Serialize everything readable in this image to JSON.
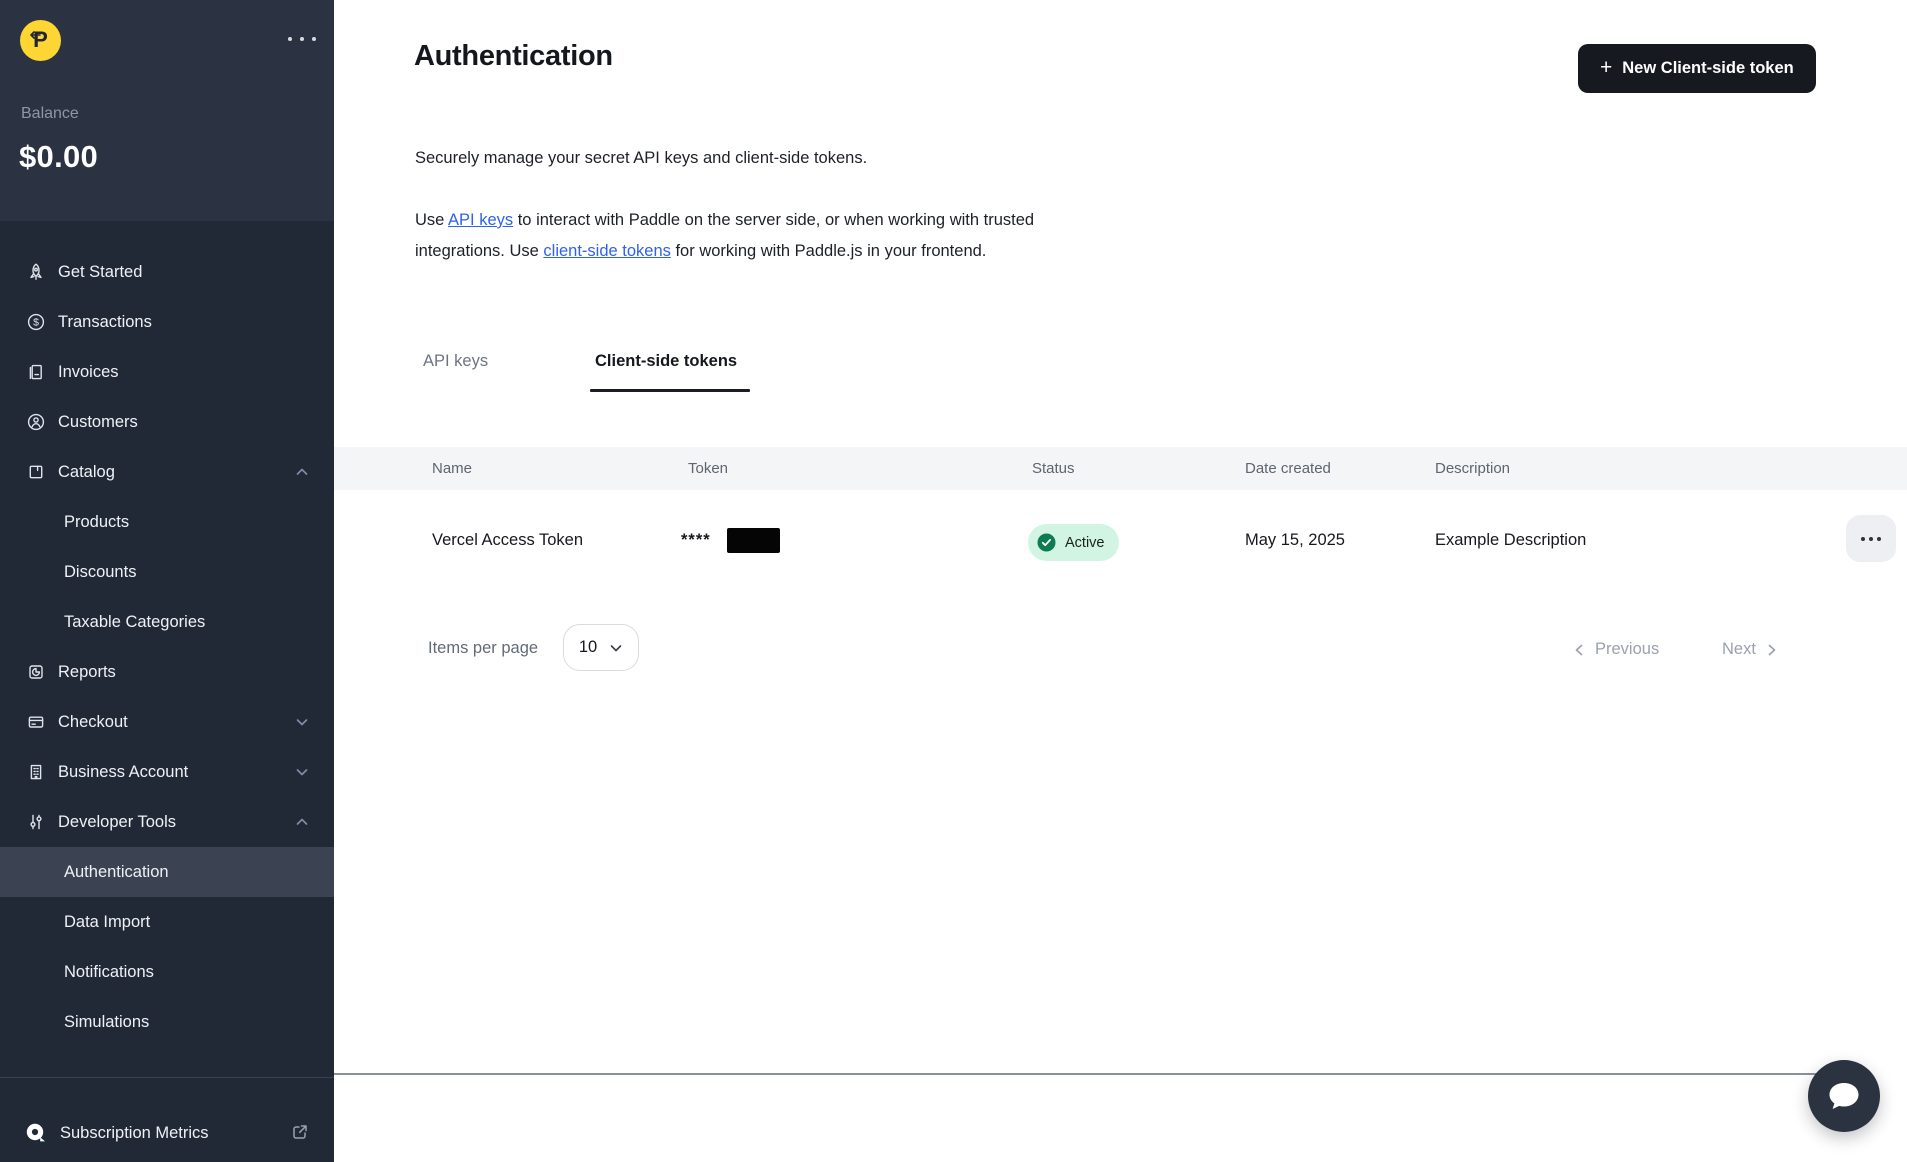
{
  "sidebar": {
    "balance_label": "Balance",
    "balance_value": "$0.00",
    "logo_letter": "P",
    "items": [
      {
        "label": "Get Started"
      },
      {
        "label": "Transactions"
      },
      {
        "label": "Invoices"
      },
      {
        "label": "Customers"
      },
      {
        "label": "Catalog"
      },
      {
        "label": "Products"
      },
      {
        "label": "Discounts"
      },
      {
        "label": "Taxable Categories"
      },
      {
        "label": "Reports"
      },
      {
        "label": "Checkout"
      },
      {
        "label": "Business Account"
      },
      {
        "label": "Developer Tools"
      },
      {
        "label": "Authentication"
      },
      {
        "label": "Data Import"
      },
      {
        "label": "Notifications"
      },
      {
        "label": "Simulations"
      }
    ],
    "footer_label": "Subscription Metrics"
  },
  "header": {
    "title": "Authentication",
    "new_token_button": "New Client-side token",
    "plus": "+"
  },
  "intro": {
    "line1": "Securely manage your secret API keys and client-side tokens.",
    "p2_part1": "Use ",
    "link1": "API keys",
    "p2_part2": " to interact with Paddle on the server side, or when working with trusted integrations. Use ",
    "link2": "client-side tokens",
    "p2_part3": " for working with Paddle.js in your frontend."
  },
  "tabs": [
    {
      "label": "API keys"
    },
    {
      "label": "Client-side tokens"
    }
  ],
  "table": {
    "columns": [
      "Name",
      "Token",
      "Status",
      "Date created",
      "Description"
    ],
    "rows": [
      {
        "name": "Vercel Access Token",
        "token_masked": "****",
        "status": "Active",
        "date_created": "May 15, 2025",
        "description": "Example Description"
      }
    ]
  },
  "pagination": {
    "items_per_page_label": "Items per page",
    "items_per_page_value": "10",
    "previous": "Previous",
    "next": "Next"
  },
  "colors": {
    "accent_yellow": "#fdd633",
    "sidebar_bg": "#222936",
    "sidebar_header_bg": "#2b3242",
    "active_item_bg": "#3b4251",
    "button_dark": "#16191f",
    "link_blue": "#2e62e9",
    "badge_bg": "#d2f5e3",
    "badge_green": "#0e7c52",
    "table_header_bg": "#f4f5f7"
  }
}
